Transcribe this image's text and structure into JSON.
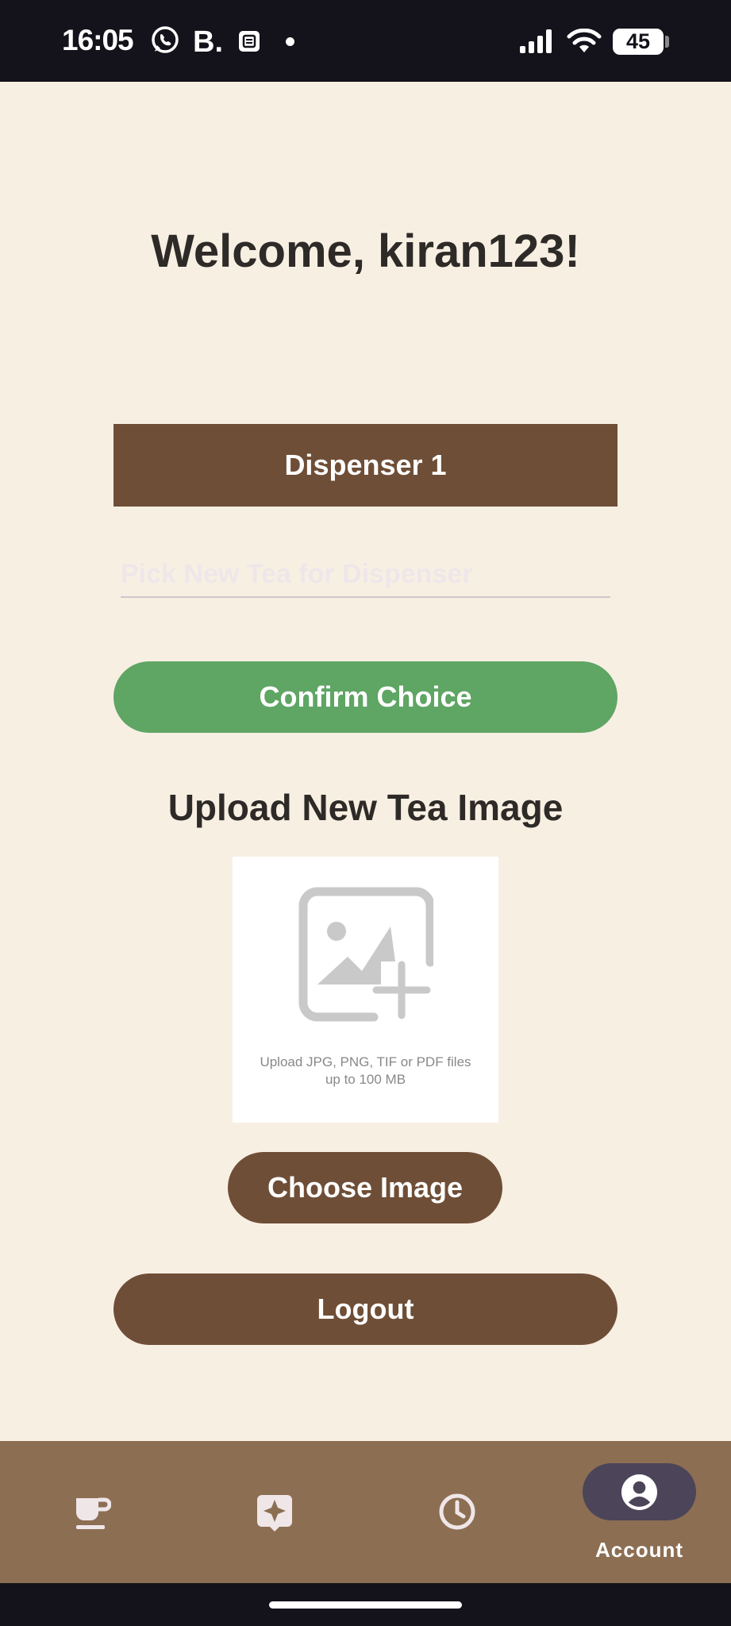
{
  "status_bar": {
    "time": "16:05",
    "notification_letter": "B.",
    "battery": "45",
    "icons": [
      "whatsapp-icon",
      "booking-icon",
      "app-icon",
      "dot-icon",
      "signal-icon",
      "wifi-icon",
      "battery-icon"
    ]
  },
  "main": {
    "welcome": "Welcome, kiran123!",
    "dispenser_label": "Dispenser 1",
    "tea_input": {
      "value": "",
      "placeholder": "Pick New Tea for Dispenser"
    },
    "confirm_button": "Confirm Choice",
    "upload_title": "Upload New Tea Image",
    "upload_hint": "Upload JPG, PNG, TIF or PDF files\nup to 100 MB",
    "choose_button": "Choose Image",
    "logout_button": "Logout"
  },
  "bottom_nav": {
    "items": [
      {
        "icon": "tea-cup-icon",
        "label": ""
      },
      {
        "icon": "sparkle-icon",
        "label": ""
      },
      {
        "icon": "clock-icon",
        "label": ""
      },
      {
        "icon": "account-icon",
        "label": "Account",
        "active": true
      }
    ]
  },
  "colors": {
    "background": "#f8efe3",
    "brown": "#6f4e37",
    "green": "#5fa564",
    "nav_bar": "#8c6e53",
    "active_pill": "#4c4459"
  }
}
